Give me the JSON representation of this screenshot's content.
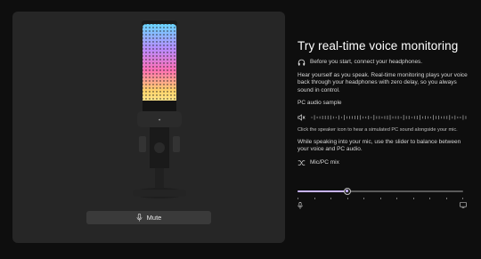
{
  "mic_panel": {
    "mute_label": "Mute",
    "mic_icon": "microphone-icon",
    "product_image": "microphone-product-image"
  },
  "monitoring": {
    "title": "Try real-time voice monitoring",
    "headphones_icon": "headphones-icon",
    "headphones_note": "Before you start, connect your headphones.",
    "description": "Hear yourself as you speak. Real-time monitoring plays your voice back through your headphones with zero delay, so you always sound in control.",
    "sample_heading": "PC audio sample",
    "speaker_icon": "speaker-muted-icon",
    "speaker_hint": "Click the speaker icon to hear a simulated PC sound alongside your mic.",
    "mix_instructions": "While speaking into your mic, use the slider to balance between your voice and PC audio.",
    "mix_label": "Mic/PC mix",
    "mix_icon": "mix-arrows-icon",
    "mix_value": 0.3,
    "slider_left_icon": "microphone-icon",
    "slider_right_icon": "monitor-icon"
  },
  "colors": {
    "accent": "#c8b4ff",
    "panel": "#262626",
    "background": "#0e0e0e"
  }
}
